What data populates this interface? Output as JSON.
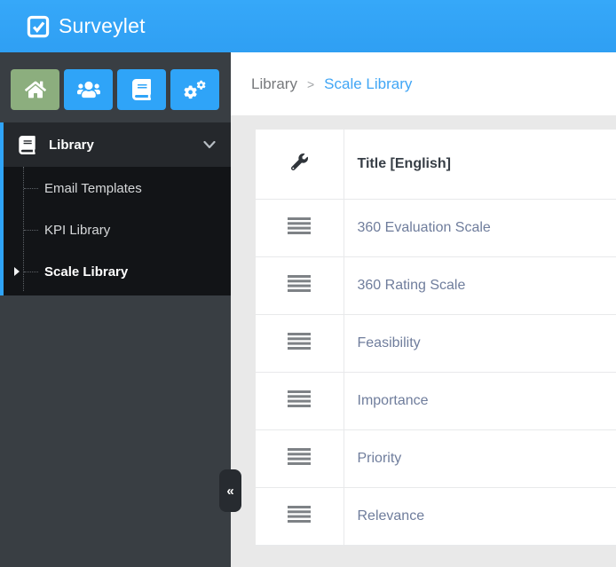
{
  "app": {
    "name": "Surveylet"
  },
  "colors": {
    "topbar_blue": "#31a4f8",
    "accent_blue": "#2fa4f8",
    "sidebar_bg": "#393e43",
    "nav_section_bg": "#25282c",
    "submenu_bg": "#121417",
    "home_button_green": "#8cae7e",
    "content_bg": "#e9e9e9",
    "row_title_color": "#6f7d9c",
    "breadcrumb_active_blue": "#41a6f5"
  },
  "topbar": {
    "logo_icon": "check-square-icon",
    "title": "Surveylet"
  },
  "sidebar": {
    "toolbar": [
      {
        "icon": "home-icon"
      },
      {
        "icon": "users-icon"
      },
      {
        "icon": "book-icon"
      },
      {
        "icon": "cogs-icon"
      }
    ],
    "nav": {
      "section_label": "Library",
      "section_icon": "book-icon",
      "chevron_icon": "chevron-down-icon",
      "items": [
        {
          "label": "Email Templates",
          "active": false
        },
        {
          "label": "KPI Library",
          "active": false
        },
        {
          "label": "Scale Library",
          "active": true
        }
      ]
    },
    "collapse_label": "«"
  },
  "breadcrumb": {
    "separator": ">",
    "items": [
      {
        "label": "Library"
      },
      {
        "label": "Scale Library"
      }
    ]
  },
  "table": {
    "header": {
      "tools_icon": "wrench-icon",
      "title_column": "Title [English]"
    },
    "rows": [
      {
        "title": "360 Evaluation Scale"
      },
      {
        "title": "360 Rating Scale"
      },
      {
        "title": "Feasibility"
      },
      {
        "title": "Importance"
      },
      {
        "title": "Priority"
      },
      {
        "title": "Relevance"
      }
    ]
  }
}
